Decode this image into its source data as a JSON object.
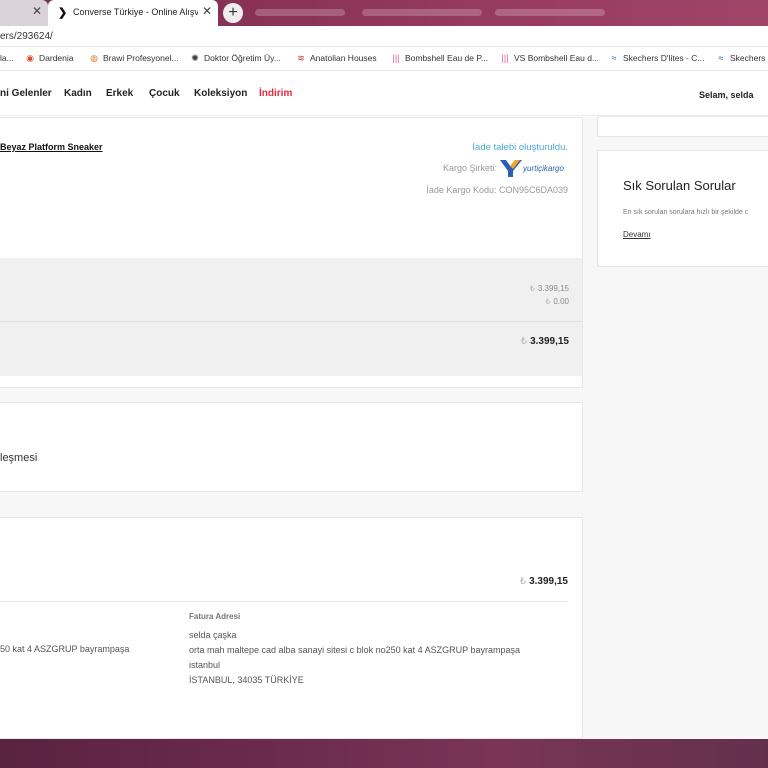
{
  "browser": {
    "prev_tab_title": "",
    "active_tab_title": "Converse Türkiye - Online Alışveriş",
    "url": "ers/293624/",
    "bookmarks": [
      {
        "label": "la..."
      },
      {
        "label": "Dardenia"
      },
      {
        "label": "Brawi Profesyonel..."
      },
      {
        "label": "Doktor Öğretim Üy..."
      },
      {
        "label": "Anatolian Houses"
      },
      {
        "label": "Bombshell Eau de P..."
      },
      {
        "label": "VS Bombshell Eau d..."
      },
      {
        "label": "Skechers D'lites - C..."
      },
      {
        "label": "Skechers"
      }
    ]
  },
  "nav": {
    "items": [
      "ni Gelenler",
      "Kadın",
      "Erkek",
      "Çocuk",
      "Koleksiyon",
      "İndirim"
    ],
    "greeting": "Selam, selda"
  },
  "order": {
    "product_name": "Beyaz Platform Sneaker",
    "return_status": "İade talebi oluşturuldu.",
    "cargo_label": "Kargo Şirketi:",
    "cargo_logo_text": "yurtiçikargo",
    "cargo_code": "İade Kargo Kodu: CON95C6DA039",
    "subtotal": "3.399,15",
    "shipping": "0.00",
    "total": "3.399,15",
    "currency_symbol": "₺"
  },
  "agreement": {
    "text": "leşmesi"
  },
  "payment": {
    "total": "3.399,15",
    "delivery_address_line": "50 kat 4 ASZGRUP bayrampaşa",
    "billing_heading": "Fatura Adresi",
    "billing_lines": [
      "selda çaşka",
      "orta mah maltepe cad alba sanayi sitesi c blok no250 kat 4 ASZGRUP bayrampaşa",
      "istanbul",
      "İSTANBUL, 34035 TÜRKİYE"
    ]
  },
  "faq": {
    "title": "Sık Sorulan Sorular",
    "description": "En sık sorulan sorulara hızlı bir şekilde c",
    "more_link": "Devamı"
  },
  "colors": {
    "accent_link": "#4aa9d8",
    "sale": "#e8283c",
    "cargo_blue": "#2b5fb3"
  }
}
